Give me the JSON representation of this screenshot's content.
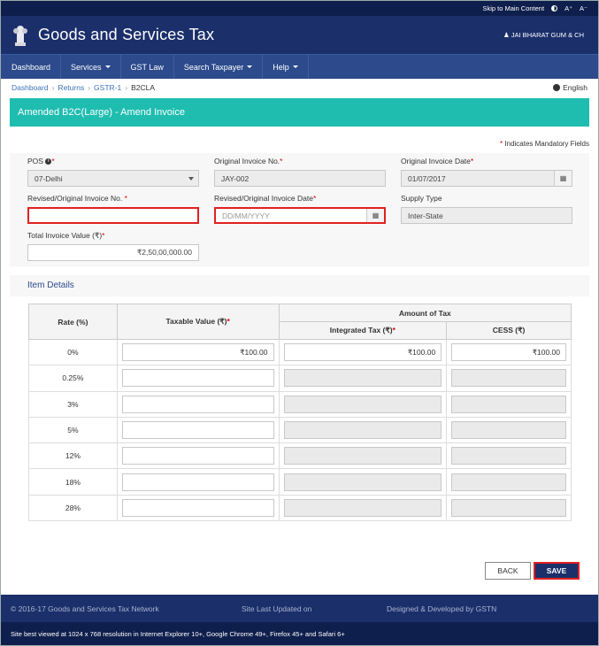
{
  "top_strip": {
    "skip_link": "Skip to Main Content",
    "font_inc": "A⁺",
    "font_dec": "A⁻"
  },
  "header": {
    "title": "Goods and Services Tax",
    "user": "JAI BHARAT GUM & CH"
  },
  "nav": [
    {
      "label": "Dashboard",
      "dropdown": false
    },
    {
      "label": "Services",
      "dropdown": true
    },
    {
      "label": "GST Law",
      "dropdown": false
    },
    {
      "label": "Search Taxpayer",
      "dropdown": true
    },
    {
      "label": "Help",
      "dropdown": true
    }
  ],
  "breadcrumb": {
    "items": [
      "Dashboard",
      "Returns",
      "GSTR-1"
    ],
    "current": "B2CLA",
    "language": "English"
  },
  "page": {
    "title": "Amended B2C(Large) - Amend Invoice",
    "mandatory_note": "Indicates Mandatory Fields"
  },
  "form": {
    "pos": {
      "label": "POS",
      "value": "07-Delhi"
    },
    "original_invoice_no": {
      "label": "Original Invoice No.",
      "value": "JAY-002"
    },
    "original_invoice_date": {
      "label": "Original Invoice Date",
      "value": "01/07/2017"
    },
    "revised_invoice_no": {
      "label": "Revised/Original Invoice No.",
      "value": ""
    },
    "revised_invoice_date": {
      "label": "Revised/Original Invoice Date",
      "placeholder": "DD/MM/YYYY"
    },
    "supply_type": {
      "label": "Supply Type",
      "value": "Inter-State"
    },
    "total_invoice_value": {
      "label": "Total Invoice Value (₹)",
      "value": "₹2,50,00,000.00"
    }
  },
  "items": {
    "section_title": "Item Details",
    "headers": {
      "rate": "Rate (%)",
      "taxable_value": "Taxable Value (₹)",
      "amount_of_tax": "Amount of Tax",
      "integrated_tax": "Integrated Tax (₹)",
      "cess": "CESS (₹)"
    },
    "rows": [
      {
        "rate": "0%",
        "taxable": "₹100.00",
        "igst": "₹100.00",
        "cess": "₹100.00"
      },
      {
        "rate": "0.25%",
        "taxable": "",
        "igst": "",
        "cess": ""
      },
      {
        "rate": "3%",
        "taxable": "",
        "igst": "",
        "cess": ""
      },
      {
        "rate": "5%",
        "taxable": "",
        "igst": "",
        "cess": ""
      },
      {
        "rate": "12%",
        "taxable": "",
        "igst": "",
        "cess": ""
      },
      {
        "rate": "18%",
        "taxable": "",
        "igst": "",
        "cess": ""
      },
      {
        "rate": "28%",
        "taxable": "",
        "igst": "",
        "cess": ""
      }
    ]
  },
  "buttons": {
    "back": "BACK",
    "save": "SAVE"
  },
  "footer": {
    "copyright": "© 2016-17 Goods and Services Tax Network",
    "updated": "Site Last Updated on",
    "designed": "Designed & Developed by GSTN",
    "browser_note": "Site best viewed at 1024 x 768 resolution in Internet Explorer 10+, Google Chrome 49+, Firefox 45+ and Safari 6+"
  },
  "colors": {
    "banner": "#1fbdb0",
    "header": "#1b2f6b",
    "nav": "#2c4a8c",
    "error": "#e02020"
  },
  "icons": {
    "emblem": "national-emblem-icon",
    "contrast": "contrast-icon",
    "user": "user-icon",
    "info": "info-icon",
    "globe": "globe-icon",
    "calendar": "calendar-icon"
  }
}
